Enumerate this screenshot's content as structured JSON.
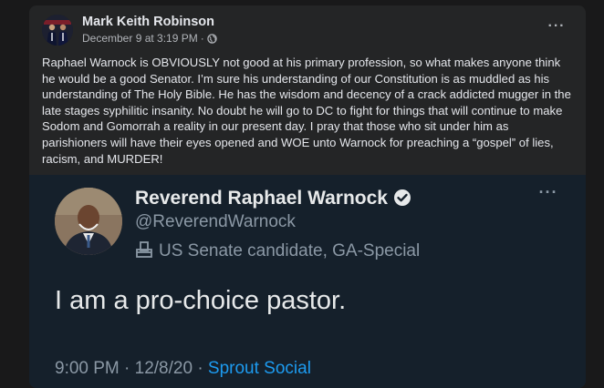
{
  "post": {
    "author": "Mark Keith Robinson",
    "date": "December 9 at 3:19 PM",
    "separator": "·",
    "privacy_icon": "globe-icon",
    "more_label": "···",
    "text": "Raphael Warnock is OBVIOUSLY not good at his primary profession, so what makes anyone think he would be a good Senator. I’m sure his understanding of our Constitution is as muddled as his understanding of The Holy Bible. He has the wisdom and decency of a crack addicted mugger in the late stages syphilitic insanity. No doubt he will go to DC to fight for things that will continue to make Sodom and Gomorrah a reality in our present day. I pray that those who sit under him as parishioners will have their eyes opened and WOE unto Warnock for preaching a “gospel” of lies, racism, and MURDER!"
  },
  "tweet": {
    "name": "Reverend Raphael Warnock",
    "handle": "@ReverendWarnock",
    "bio": "US Senate candidate, GA-Special",
    "more_label": "···",
    "body": "I am a pro-choice pastor.",
    "time": "9:00 PM · 12/8/20 · ",
    "source": "Sprout Social"
  },
  "colors": {
    "fb_card": "#242526",
    "tweet_bg": "#15202b",
    "twitter_blue": "#1d9bf0"
  }
}
